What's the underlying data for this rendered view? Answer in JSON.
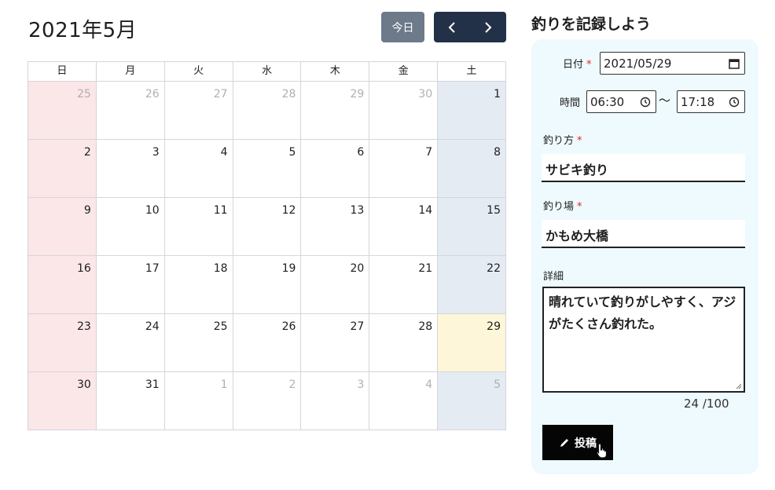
{
  "calendar": {
    "title": "2021年5月",
    "today_label": "今日",
    "weekdays": [
      "日",
      "月",
      "火",
      "水",
      "木",
      "金",
      "土"
    ],
    "weeks": [
      [
        {
          "d": "25",
          "other": true
        },
        {
          "d": "26",
          "other": true
        },
        {
          "d": "27",
          "other": true
        },
        {
          "d": "28",
          "other": true
        },
        {
          "d": "29",
          "other": true
        },
        {
          "d": "30",
          "other": true
        },
        {
          "d": "1"
        }
      ],
      [
        {
          "d": "2"
        },
        {
          "d": "3"
        },
        {
          "d": "4"
        },
        {
          "d": "5"
        },
        {
          "d": "6"
        },
        {
          "d": "7"
        },
        {
          "d": "8"
        }
      ],
      [
        {
          "d": "9"
        },
        {
          "d": "10"
        },
        {
          "d": "11"
        },
        {
          "d": "12"
        },
        {
          "d": "13"
        },
        {
          "d": "14"
        },
        {
          "d": "15"
        }
      ],
      [
        {
          "d": "16"
        },
        {
          "d": "17"
        },
        {
          "d": "18"
        },
        {
          "d": "19"
        },
        {
          "d": "20"
        },
        {
          "d": "21"
        },
        {
          "d": "22"
        }
      ],
      [
        {
          "d": "23"
        },
        {
          "d": "24"
        },
        {
          "d": "25"
        },
        {
          "d": "26"
        },
        {
          "d": "27"
        },
        {
          "d": "28"
        },
        {
          "d": "29",
          "today": true
        }
      ],
      [
        {
          "d": "30"
        },
        {
          "d": "31"
        },
        {
          "d": "1",
          "other": true
        },
        {
          "d": "2",
          "other": true
        },
        {
          "d": "3",
          "other": true
        },
        {
          "d": "4",
          "other": true
        },
        {
          "d": "5",
          "other": true
        }
      ]
    ],
    "colors": {
      "sunday_bg": "#fbe6e8",
      "saturday_bg": "#e5ebf3",
      "today_bg": "#fdf6d8",
      "nav_bg": "#233148",
      "today_btn_bg": "#6c7a8a"
    }
  },
  "form": {
    "heading": "釣りを記録しよう",
    "date_label": "日付",
    "required_mark": "*",
    "date_value": "2021/05/29",
    "time_label": "時間",
    "time_start": "06:30",
    "time_separator": "〜",
    "time_end": "17:18",
    "method_label": "釣り方",
    "method_value": "サビキ釣り",
    "place_label": "釣り場",
    "place_value": "かもめ大橋",
    "detail_label": "詳細",
    "detail_value": "晴れていて釣りがしやすく、アジがたくさん釣れた。",
    "char_count": "24 /100",
    "submit_label": "投稿",
    "panel_bg": "#eefafd",
    "required_color": "#e0252b"
  },
  "icons": [
    "chevron-left-icon",
    "chevron-right-icon",
    "calendar-icon",
    "clock-icon",
    "pencil-icon",
    "hand-pointer-icon"
  ]
}
